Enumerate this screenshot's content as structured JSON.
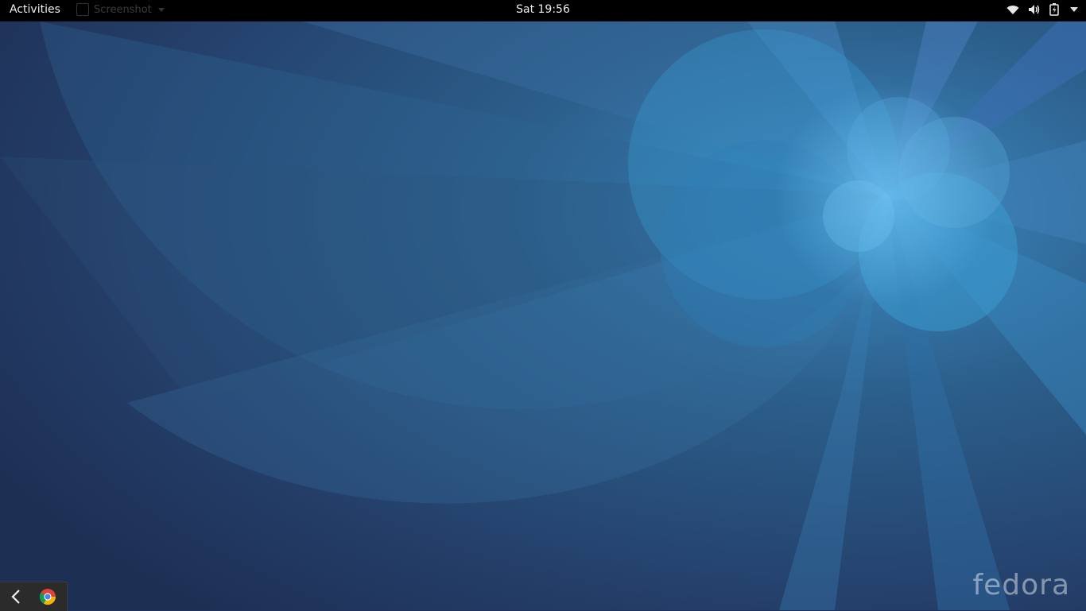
{
  "topbar": {
    "activities_label": "Activities",
    "app_menu_label": "Screenshot",
    "clock": "Sat 19:56"
  },
  "status_icons": [
    "wifi-icon",
    "volume-icon",
    "battery-icon",
    "system-menu-caret-icon"
  ],
  "dock": {
    "items": [
      "back-arrow-icon",
      "chrome-icon"
    ]
  },
  "wallpaper": {
    "watermark": "fedora",
    "colors": {
      "base": "#1f3358",
      "mid": "#2a5a86",
      "light": "#3a8fc4",
      "accent": "#5aa8d8"
    }
  }
}
